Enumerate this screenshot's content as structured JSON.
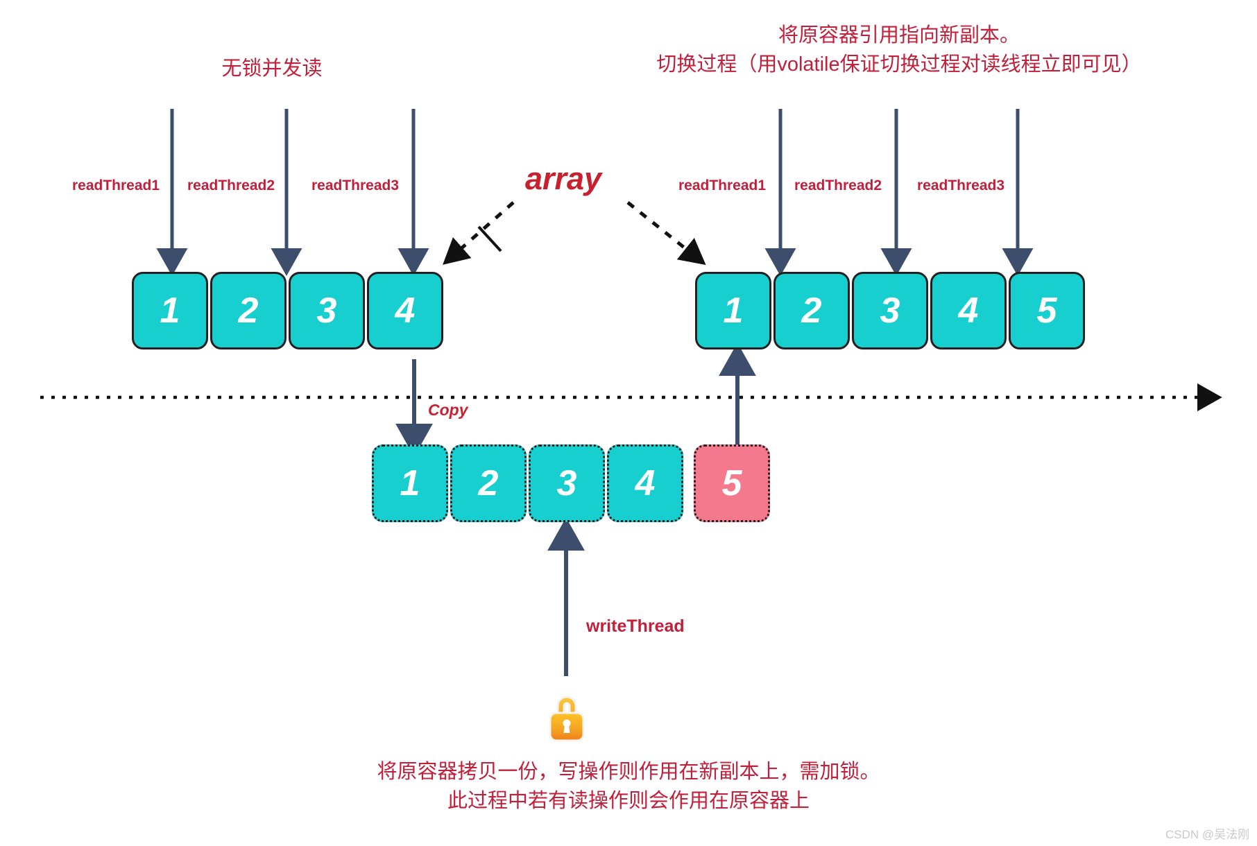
{
  "diagram": {
    "title_note_left": "无锁并发读",
    "note_right_line1": "将原容器引用指向新副本。",
    "note_right_line2": "切换过程（用volatile保证切换过程对读线程立即可见）",
    "array_pointer_label": "array",
    "copy_label": "Copy",
    "write_thread_label": "writeThread",
    "bottom_note_line1": "将原容器拷贝一份，写操作则作用在新副本上，需加锁。",
    "bottom_note_line2": "此过程中若有读操作则会作用在原容器上",
    "watermark": "CSDN @吴法刚",
    "lock_icon_name": "lock-icon"
  },
  "read_threads_left": [
    {
      "label": "readThread1"
    },
    {
      "label": "readThread2"
    },
    {
      "label": "readThread3"
    }
  ],
  "read_threads_right": [
    {
      "label": "readThread1"
    },
    {
      "label": "readThread2"
    },
    {
      "label": "readThread3"
    }
  ],
  "arrays": {
    "original": {
      "name": "original-array",
      "style": "solid",
      "cells": [
        {
          "value": "1",
          "kind": "teal"
        },
        {
          "value": "2",
          "kind": "teal"
        },
        {
          "value": "3",
          "kind": "teal"
        },
        {
          "value": "4",
          "kind": "teal"
        }
      ]
    },
    "copy": {
      "name": "copy-array",
      "style": "dotted",
      "cells": [
        {
          "value": "1",
          "kind": "teal"
        },
        {
          "value": "2",
          "kind": "teal"
        },
        {
          "value": "3",
          "kind": "teal"
        },
        {
          "value": "4",
          "kind": "teal"
        },
        {
          "value": "5",
          "kind": "pink"
        }
      ]
    },
    "new_reference": {
      "name": "new-array",
      "style": "solid",
      "cells": [
        {
          "value": "1",
          "kind": "teal"
        },
        {
          "value": "2",
          "kind": "teal"
        },
        {
          "value": "3",
          "kind": "teal"
        },
        {
          "value": "4",
          "kind": "teal"
        },
        {
          "value": "5",
          "kind": "teal"
        }
      ]
    }
  },
  "colors": {
    "teal": "#17cfcf",
    "pink": "#f4798c",
    "red_text": "#c2203a",
    "arrow_navy": "#3d4e6c",
    "border_black": "#231f20",
    "timeline": "#111111",
    "watermark": "#c9c9c9"
  }
}
